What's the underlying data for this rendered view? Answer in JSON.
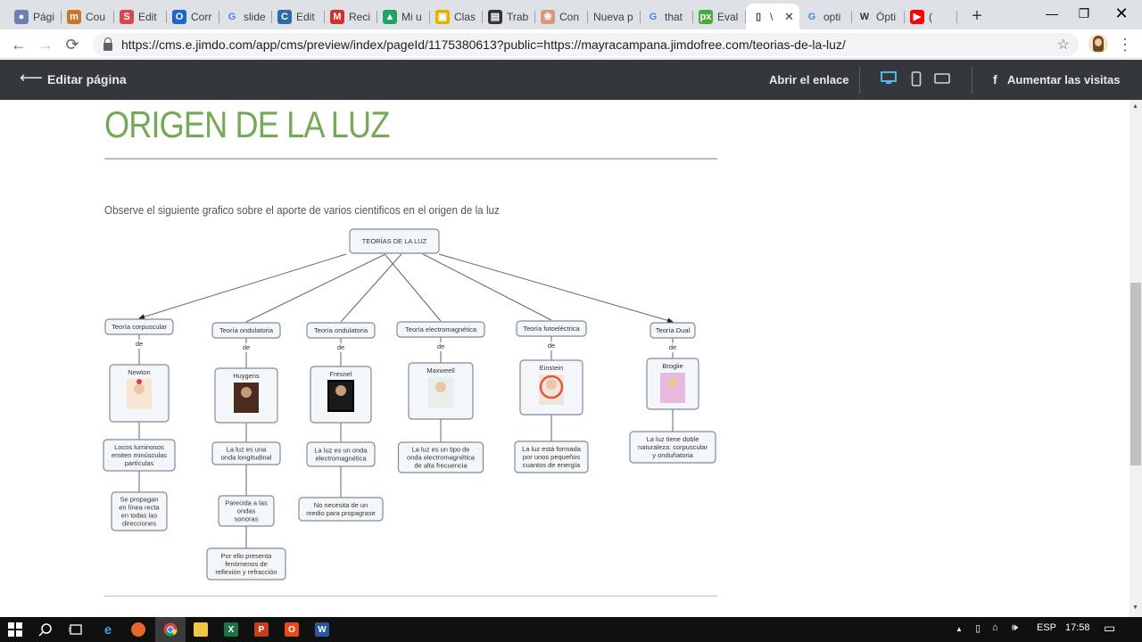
{
  "browser": {
    "tabs": [
      {
        "label": "Pági",
        "icon": "globe-icon",
        "color": "#6b7fb0",
        "glyph": "●"
      },
      {
        "label": "Cou",
        "icon": "coursera-icon",
        "color": "#c8772a",
        "glyph": "m"
      },
      {
        "label": "Edit",
        "icon": "slides-editor-icon",
        "color": "#d44a4a",
        "glyph": "S"
      },
      {
        "label": "Corr",
        "icon": "outlook-icon",
        "color": "#1e66c4",
        "glyph": "O"
      },
      {
        "label": "slide",
        "icon": "google-icon",
        "color": "#4285f4",
        "glyph": "G"
      },
      {
        "label": "Edit",
        "icon": "classroom-icon",
        "color": "#2c6ab0",
        "glyph": "C"
      },
      {
        "label": "Reci",
        "icon": "gmail-icon",
        "color": "#d93025",
        "glyph": "M"
      },
      {
        "label": "Mi u",
        "icon": "drive-icon",
        "color": "#1fa463",
        "glyph": "▲"
      },
      {
        "label": "Clas",
        "icon": "classroom-board-icon",
        "color": "#e2b200",
        "glyph": "▣"
      },
      {
        "label": "Trab",
        "icon": "portfolio-icon",
        "color": "#333333",
        "glyph": "▤"
      },
      {
        "label": "Con",
        "icon": "brain-icon",
        "color": "#d49a7a",
        "glyph": "❀"
      },
      {
        "label": "Nueva p",
        "icon": "",
        "color": "",
        "glyph": ""
      },
      {
        "label": "that",
        "icon": "google-icon",
        "color": "#4285f4",
        "glyph": "G"
      },
      {
        "label": "Eval",
        "icon": "pixton-icon",
        "color": "#49a942",
        "glyph": "px"
      },
      {
        "label": "\\",
        "icon": "page-icon",
        "color": "#ffffff",
        "glyph": "▯",
        "active": true
      },
      {
        "label": "opti",
        "icon": "google-icon",
        "color": "#4285f4",
        "glyph": "G"
      },
      {
        "label": "Ópti",
        "icon": "wikipedia-icon",
        "color": "#ffffff",
        "glyph": "W"
      },
      {
        "label": "(",
        "icon": "youtube-icon",
        "color": "#ff0000",
        "glyph": "▶"
      }
    ],
    "url": "https://cms.e.jimdo.com/app/cms/preview/index/pageId/1175380613?public=https://mayracampana.jimdofree.com/teorias-de-la-luz/"
  },
  "jimdo": {
    "edit_page": "Editar página",
    "open_link": "Abrir el enlace",
    "boost_visits": "Aumentar las visitas"
  },
  "page": {
    "title": "ORIGEN DE LA LUZ",
    "intro": "Observe el siguiente grafico sobre el aporte de varios cientificos en el origen de la luz"
  },
  "concept_map": {
    "root": "TEORÍAS DE LA LUZ",
    "connector": "de",
    "branches": [
      {
        "theory": "Teoría corpuscular",
        "scientist": "Newton",
        "facts": [
          [
            "Locos luminosos",
            "emiten minúsculas",
            "partículas"
          ],
          [
            "Se propagan",
            "en línea recta",
            "en todas las",
            "direcciones"
          ]
        ]
      },
      {
        "theory": "Teoría ondulatoria",
        "scientist": "Huygens",
        "facts": [
          [
            "La  luz es una",
            "onda longitudinal"
          ],
          [
            "Parecida a las",
            "ondas",
            "sonoras"
          ],
          [
            "Por ello presenta",
            "fenómenos de",
            "reflexión y refracción"
          ]
        ]
      },
      {
        "theory": "Teoría ondulatoria",
        "scientist": "Fresnel",
        "facts": [
          [
            "La luz es un onda",
            "electromagnética"
          ],
          [
            "No necesita de un",
            "medio para propagrase"
          ]
        ]
      },
      {
        "theory": "Teoría electromagnética",
        "scientist": "Maxweell",
        "facts": [
          [
            "La luz es un tipo de",
            "onda electromagnética",
            "de alta frecuencia"
          ]
        ]
      },
      {
        "theory": "Teoría fotoeléctrica",
        "scientist": "Einstein",
        "facts": [
          [
            "La luz está formada",
            "por unos pequeños",
            "cuantos de energía"
          ]
        ]
      },
      {
        "theory": "Teoría Dual",
        "scientist": "Broglie",
        "facts": [
          [
            "La luz tiene doble",
            "naturaleza: corpuscular",
            "y onduñatoria"
          ]
        ]
      }
    ]
  },
  "taskbar": {
    "language": "ESP",
    "time": "17:58"
  }
}
